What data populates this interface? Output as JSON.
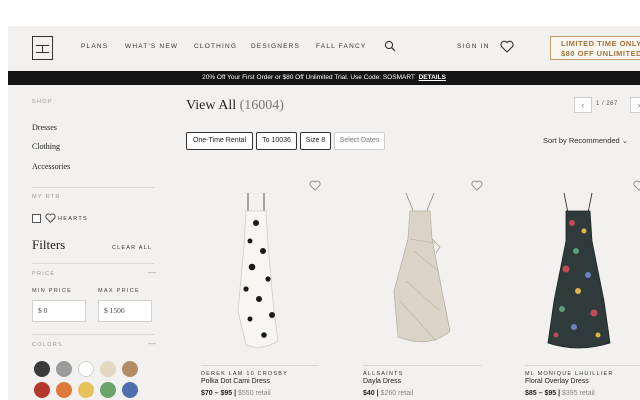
{
  "header": {
    "nav": [
      "PLANS",
      "WHAT'S NEW",
      "CLOTHING",
      "DESIGNERS",
      "FALL FANCY"
    ],
    "sign_in": "SIGN IN",
    "promo_line1": "LIMITED TIME ONLY",
    "promo_line2": "$80 OFF UNLIMITED"
  },
  "banner": {
    "text": "20% Off Your First Order or $80 Off Unlimited Trial. Use Code: SOSMART",
    "link": "DETAILS"
  },
  "sidebar": {
    "shop_label": "SHOP",
    "shop_links": [
      "Dresses",
      "Clothing",
      "Accessories"
    ],
    "my_rtr_label": "MY RTR",
    "hearts_label": "HEARTS",
    "filters_title": "Filters",
    "clear_all": "CLEAR ALL",
    "price_label": "PRICE",
    "min_price_label": "MIN PRICE",
    "max_price_label": "MAX PRICE",
    "min_price_value": "$ 0",
    "max_price_value": "$ 1500",
    "colors_label": "COLORS",
    "collapse_symbol": "—",
    "colors": [
      "#3a3a3a",
      "#9b9b9b",
      "#ffffff",
      "#e3d6c3",
      "#b58b63",
      "#b5382e",
      "#e07a3c",
      "#e6c25a",
      "#6aa56a",
      "#4f6fb0"
    ]
  },
  "main": {
    "title": "View All",
    "count": "(16004)",
    "pager": {
      "prev": "‹",
      "next": "›",
      "text": "1 / 267"
    },
    "chips": [
      "One-Time Rental",
      "To 10036",
      "Size 8",
      "Select Dates"
    ],
    "sort": "Sort by Recommended",
    "sort_arrow": "⌄",
    "products": [
      {
        "designer": "DEREK LAM 10 CROSBY",
        "name": "Polka Dot Cami Dress",
        "price": "$70 – $95",
        "retail": "$550 retail"
      },
      {
        "designer": "ALLSAINTS",
        "name": "Dayla Dress",
        "price": "$40",
        "retail": "$260 retail"
      },
      {
        "designer": "ML MONIQUE LHUILLIER",
        "name": "Floral Overlay Dress",
        "price": "$85 – $95",
        "retail": "$395 retail"
      }
    ]
  },
  "icons": {
    "search": "search-icon",
    "heart": "heart-icon",
    "logo": "rtr-logo"
  }
}
